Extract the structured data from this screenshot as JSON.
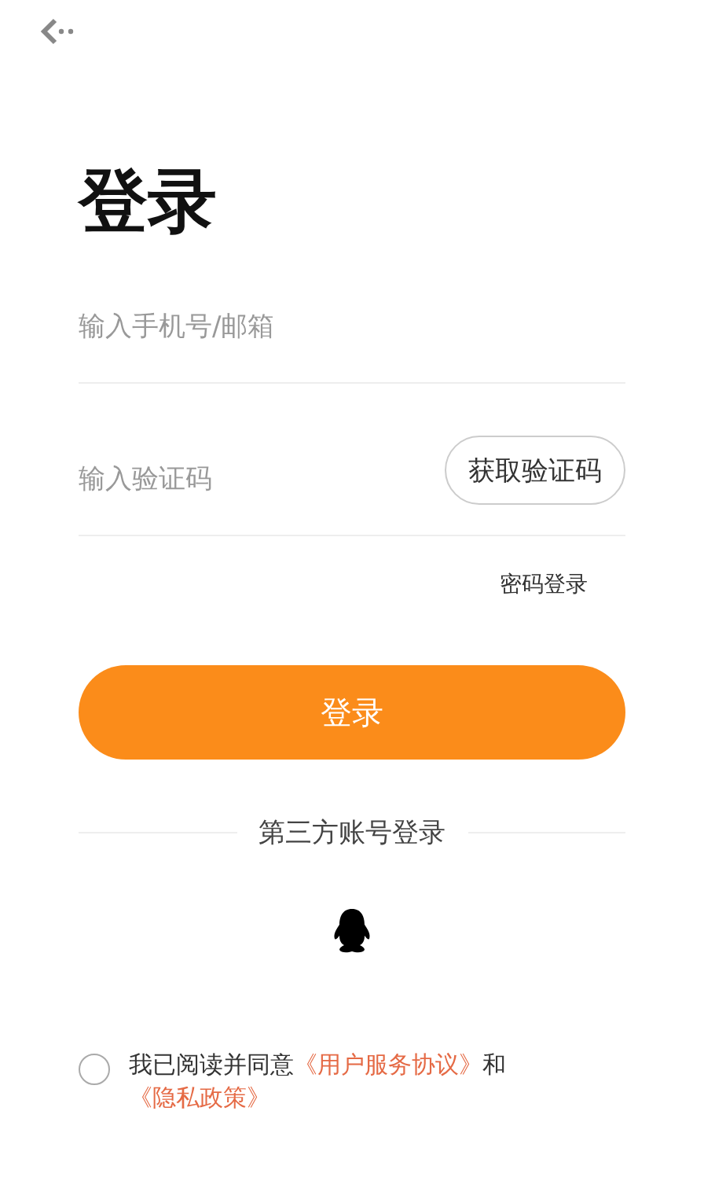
{
  "title": "登录",
  "fields": [
    {
      "placeholder": "输入手机号/邮箱"
    },
    {
      "placeholder": "输入验证码",
      "button": "获取验证码"
    }
  ],
  "password_login_link": "密码登录",
  "login_button": "登录",
  "third_party": {
    "label": "第三方账号登录"
  },
  "agreement": {
    "checked": false,
    "parts": [
      {
        "kind": "text",
        "text": "我已阅读并同意"
      },
      {
        "kind": "link",
        "text": "《用户服务协议》"
      },
      {
        "kind": "text",
        "text": "和"
      },
      {
        "kind": "link",
        "text": "《隐私政策》"
      }
    ]
  }
}
